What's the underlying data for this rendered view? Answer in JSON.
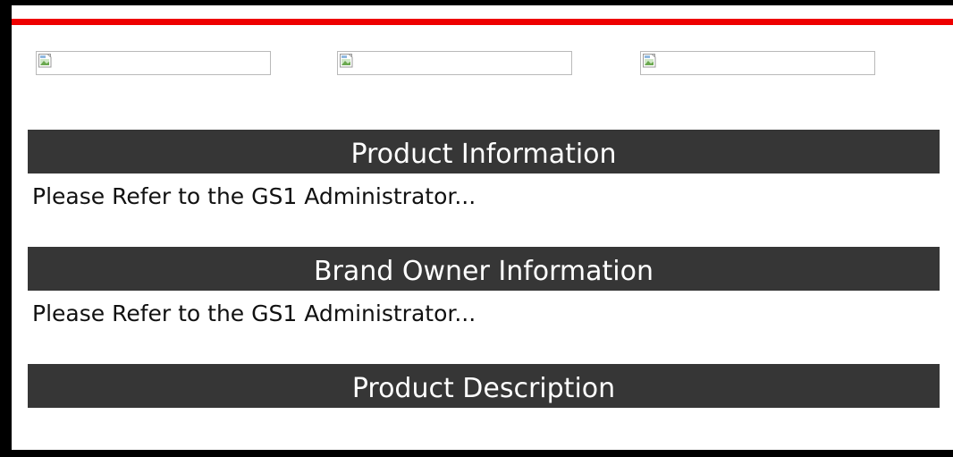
{
  "images": [
    {
      "icon": "broken-image-icon"
    },
    {
      "icon": "broken-image-icon"
    },
    {
      "icon": "broken-image-icon"
    }
  ],
  "sections": {
    "product_info": {
      "title": "Product Information",
      "body": "Please Refer to the GS1 Administrator..."
    },
    "brand_owner": {
      "title": "Brand Owner Information",
      "body": "Please Refer to the GS1 Administrator..."
    },
    "product_description": {
      "title": "Product Description",
      "body": ""
    }
  },
  "colors": {
    "accent_bar": "#ee0000",
    "header_bg": "#363636",
    "header_text": "#ffffff",
    "frame": "#000000"
  }
}
